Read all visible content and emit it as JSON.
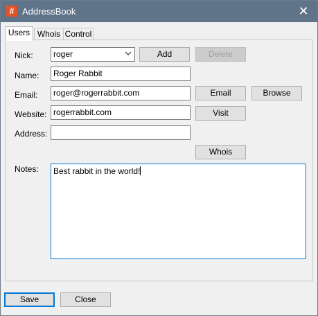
{
  "window": {
    "title": "AddressBook",
    "icon": "hash-icon",
    "icon_glyph": "#"
  },
  "tabs": [
    "Users",
    "Whois",
    "Control"
  ],
  "labels": {
    "nick": "Nick:",
    "name": "Name:",
    "email": "Email:",
    "website": "Website:",
    "address": "Address:",
    "notes": "Notes:"
  },
  "fields": {
    "nick": "roger",
    "name": "Roger Rabbit",
    "email": "roger@rogerrabbit.com",
    "website": "rogerrabbit.com",
    "address": "",
    "notes": "Best rabbit in the world!"
  },
  "buttons": {
    "add": "Add",
    "delete": "Delete",
    "email": "Email",
    "browse": "Browse",
    "visit": "Visit",
    "whois": "Whois",
    "save": "Save",
    "close": "Close"
  },
  "colors": {
    "titlebar": "#5f7389",
    "accent": "#0078d7",
    "icon": "#e0532b"
  }
}
